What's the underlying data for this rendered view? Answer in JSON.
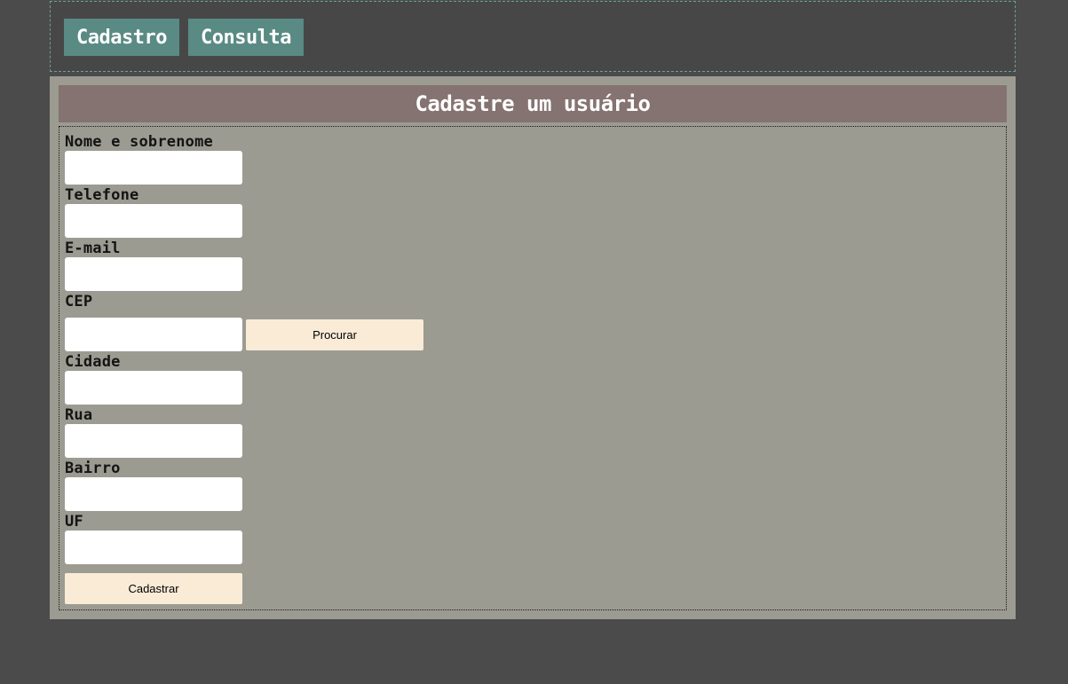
{
  "nav": {
    "cadastro_label": "Cadastro",
    "consulta_label": "Consulta"
  },
  "form": {
    "title": "Cadastre um usuário",
    "fields": {
      "nome": {
        "label": "Nome e sobrenome",
        "value": ""
      },
      "telefone": {
        "label": "Telefone",
        "value": ""
      },
      "email": {
        "label": "E-mail",
        "value": ""
      },
      "cep": {
        "label": "CEP",
        "value": ""
      },
      "cidade": {
        "label": "Cidade",
        "value": ""
      },
      "rua": {
        "label": "Rua",
        "value": ""
      },
      "bairro": {
        "label": "Bairro",
        "value": ""
      },
      "uf": {
        "label": "UF",
        "value": ""
      }
    },
    "procurar_label": "Procurar",
    "cadastrar_label": "Cadastrar"
  },
  "colors": {
    "background": "#4b4b4b",
    "nav_button": "#5a8a84",
    "panel": "#9b9b92",
    "header": "#857371",
    "action_button": "#faebd7"
  }
}
